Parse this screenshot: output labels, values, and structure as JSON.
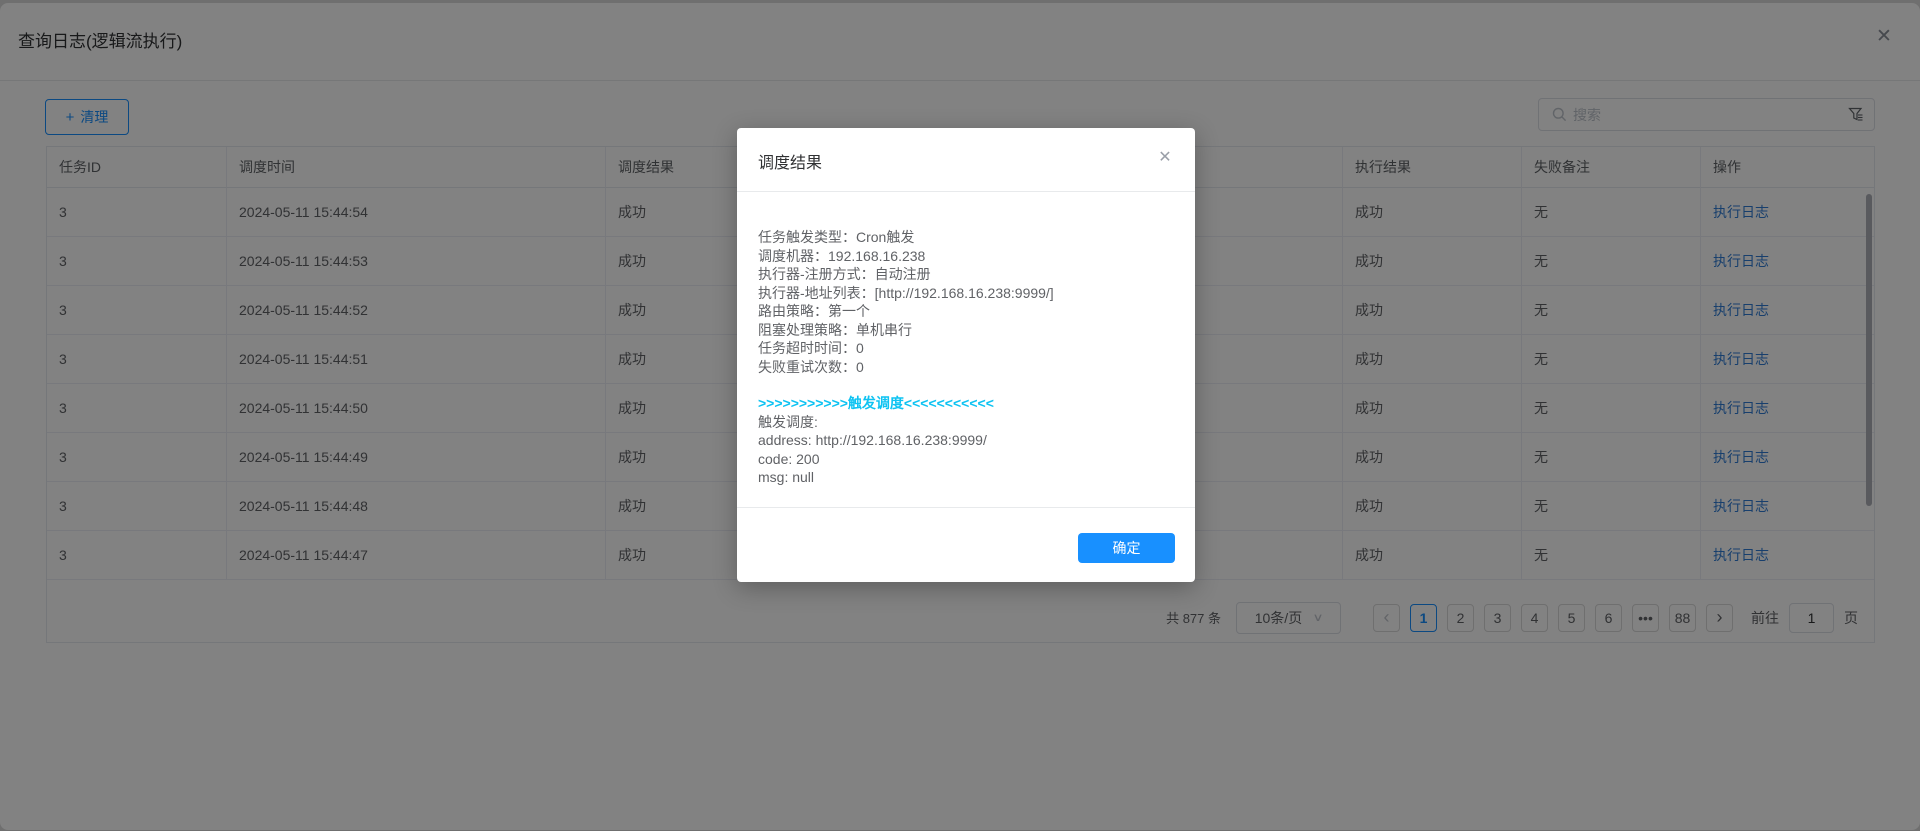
{
  "colors": {
    "accent": "#1890ff",
    "link": "#2f7dd6",
    "cyan": "#0ec3f2"
  },
  "app": {
    "title": "查询日志(逻辑流执行)",
    "close_icon": "✕"
  },
  "toolbar": {
    "clean_label": "清理",
    "plus_icon": "+",
    "search_placeholder": "搜索"
  },
  "table": {
    "columns": [
      "任务ID",
      "调度时间",
      "调度结果",
      "执行结果",
      "失败备注",
      "操作"
    ],
    "rows": [
      {
        "task_id": "3",
        "time": "2024-05-11 15:44:54",
        "dispatch_result": "成功",
        "exec_result": "成功",
        "fail_note": "无",
        "action": "执行日志"
      },
      {
        "task_id": "3",
        "time": "2024-05-11 15:44:53",
        "dispatch_result": "成功",
        "exec_result": "成功",
        "fail_note": "无",
        "action": "执行日志"
      },
      {
        "task_id": "3",
        "time": "2024-05-11 15:44:52",
        "dispatch_result": "成功",
        "exec_result": "成功",
        "fail_note": "无",
        "action": "执行日志"
      },
      {
        "task_id": "3",
        "time": "2024-05-11 15:44:51",
        "dispatch_result": "成功",
        "exec_result": "成功",
        "fail_note": "无",
        "action": "执行日志"
      },
      {
        "task_id": "3",
        "time": "2024-05-11 15:44:50",
        "dispatch_result": "成功",
        "exec_result": "成功",
        "fail_note": "无",
        "action": "执行日志"
      },
      {
        "task_id": "3",
        "time": "2024-05-11 15:44:49",
        "dispatch_result": "成功",
        "exec_result": "成功",
        "fail_note": "无",
        "action": "执行日志"
      },
      {
        "task_id": "3",
        "time": "2024-05-11 15:44:48",
        "dispatch_result": "成功",
        "exec_result": "成功",
        "fail_note": "无",
        "action": "执行日志"
      },
      {
        "task_id": "3",
        "time": "2024-05-11 15:44:47",
        "dispatch_result": "成功",
        "exec_result": "成功",
        "fail_note": "无",
        "action": "执行日志"
      }
    ]
  },
  "pagination": {
    "total": "共 877 条",
    "page_size": "10条/页",
    "chevron_down_icon": "∨",
    "prev_icon": "‹",
    "next_icon": "›",
    "pages": [
      {
        "label": "1",
        "active": true
      },
      {
        "label": "2"
      },
      {
        "label": "3"
      },
      {
        "label": "4"
      },
      {
        "label": "5"
      },
      {
        "label": "6"
      },
      {
        "label": "•••",
        "more": true
      },
      {
        "label": "88"
      }
    ],
    "goto_label": "前往",
    "goto_value": "1",
    "goto_suffix": "页"
  },
  "modal": {
    "title": "调度结果",
    "close_icon": "✕",
    "info_lines": [
      "任务触发类型：Cron触发",
      "调度机器：192.168.16.238",
      "执行器-注册方式：自动注册",
      "执行器-地址列表：[http://192.168.16.238:9999/]",
      "路由策略：第一个",
      "阻塞处理策略：单机串行",
      "任务超时时间：0",
      "失败重试次数：0"
    ],
    "highlight_line": ">>>>>>>>>>>触发调度<<<<<<<<<<<",
    "result_lines": [
      "触发调度:",
      "address: http://192.168.16.238:9999/",
      "code: 200",
      "msg: null"
    ],
    "ok_label": "确定"
  }
}
